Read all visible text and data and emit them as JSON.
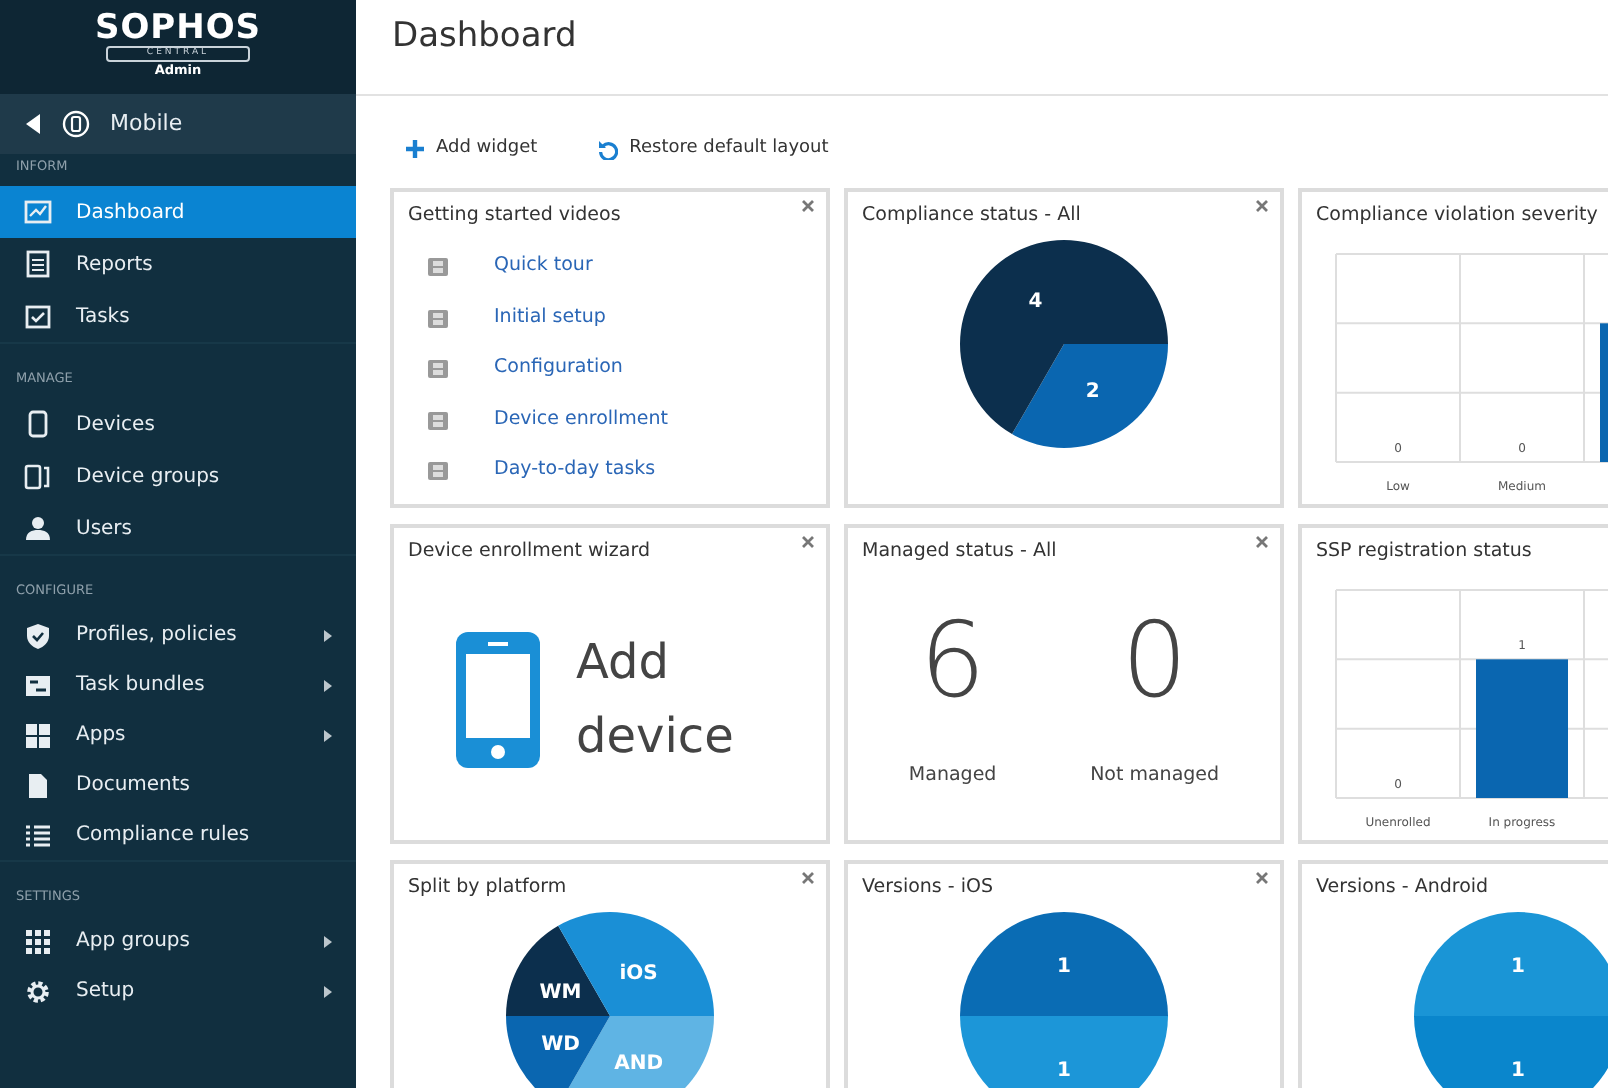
{
  "sidebar": {
    "logo": {
      "brand": "SOPHOS",
      "product": "CENTRAL",
      "role": "Admin"
    },
    "back": {
      "label": "Mobile"
    },
    "sections": [
      {
        "label": "INFORM",
        "items": [
          {
            "label": "Dashboard",
            "selected": true,
            "submenu": false
          },
          {
            "label": "Reports",
            "selected": false,
            "submenu": false
          },
          {
            "label": "Tasks",
            "selected": false,
            "submenu": false
          }
        ]
      },
      {
        "label": "MANAGE",
        "items": [
          {
            "label": "Devices",
            "selected": false,
            "submenu": false
          },
          {
            "label": "Device groups",
            "selected": false,
            "submenu": false
          },
          {
            "label": "Users",
            "selected": false,
            "submenu": false
          }
        ]
      },
      {
        "label": "CONFIGURE",
        "items": [
          {
            "label": "Profiles, policies",
            "selected": false,
            "submenu": true
          },
          {
            "label": "Task bundles",
            "selected": false,
            "submenu": true
          },
          {
            "label": "Apps",
            "selected": false,
            "submenu": true
          },
          {
            "label": "Documents",
            "selected": false,
            "submenu": false
          },
          {
            "label": "Compliance rules",
            "selected": false,
            "submenu": false
          }
        ]
      },
      {
        "label": "SETTINGS",
        "items": [
          {
            "label": "App groups",
            "selected": false,
            "submenu": true
          },
          {
            "label": "Setup",
            "selected": false,
            "submenu": true
          }
        ]
      }
    ]
  },
  "page_title": "Dashboard",
  "toolbar": [
    {
      "kind": "add",
      "label": "Add widget"
    },
    {
      "kind": "restore",
      "label": "Restore default layout"
    }
  ],
  "widgets": [
    {
      "kind": "videos",
      "title": "Getting started videos",
      "closable": true,
      "links": [
        "Quick tour",
        "Initial setup",
        "Configuration",
        "Device enrollment",
        "Day-to-day tasks"
      ]
    },
    {
      "kind": "chart",
      "title": "Compliance status - All",
      "closable": true,
      "chart_data": {
        "type": "pie",
        "values": [
          2,
          4
        ],
        "colors": [
          "#0a66b0",
          "#0c2f4d"
        ],
        "data_labels": true
      }
    },
    {
      "kind": "columns",
      "title": "Compliance violation severity",
      "closable": false,
      "columns": [
        {
          "category": "Low",
          "value_label": "0"
        },
        {
          "category": "Medium",
          "value_label": "0"
        },
        {
          "bar": true
        }
      ]
    },
    {
      "kind": "wizard",
      "title": "Device enrollment wizard",
      "closable": true,
      "action": "Add device"
    },
    {
      "kind": "counts",
      "title": "Managed status - All",
      "closable": true,
      "counts": [
        {
          "value": "6",
          "label": "Managed"
        },
        {
          "value": "0",
          "label": "Not managed"
        }
      ]
    },
    {
      "kind": "chart",
      "title": "SSP registration status",
      "closable": false,
      "chart_data": {
        "type": "bar",
        "categories": [
          "Unenrolled",
          "In progress",
          null
        ],
        "values": [
          0,
          1,
          null
        ],
        "value_labels": [
          "0",
          "1",
          null
        ],
        "color": "#0a66b0"
      }
    },
    {
      "kind": "chart",
      "title": "Split by platform",
      "closable": true,
      "chart_data": {
        "type": "pie",
        "categories": [
          "AND",
          "WD",
          "WM",
          "iOS"
        ],
        "values": [
          33.3,
          16.7,
          16.7,
          33.3
        ],
        "colors": [
          "#5fb4e4",
          "#0a66b0",
          "#0c2f4d",
          "#1a8fd6"
        ]
      }
    },
    {
      "kind": "chart",
      "title": "Versions - iOS",
      "closable": true,
      "chart_data": {
        "type": "pie",
        "values": [
          1,
          1
        ],
        "colors": [
          "#1c96d8",
          "#0a6cb4"
        ],
        "data_labels": true
      }
    },
    {
      "kind": "chart",
      "title": "Versions - Android",
      "closable": false,
      "chart_data": {
        "type": "pie",
        "values": [
          1,
          1
        ],
        "colors": [
          "#0a86cc",
          "#1a95d6"
        ],
        "data_labels": true
      }
    }
  ]
}
